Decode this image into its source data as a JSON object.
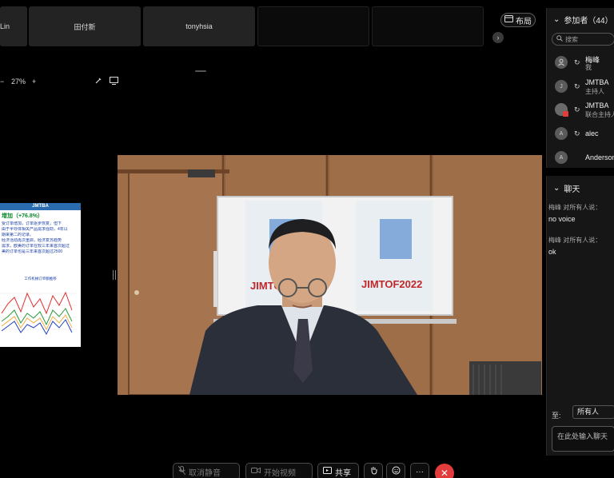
{
  "participant_tiles": [
    {
      "label": "Lin"
    },
    {
      "label": "田付新"
    },
    {
      "label": "tonyhsia"
    },
    {
      "label": ""
    },
    {
      "label": ""
    }
  ],
  "layout_button": {
    "label": "布局"
  },
  "zoom": {
    "minus": "−",
    "value": "27%",
    "plus": "+"
  },
  "shared_doc": {
    "header": "JMTBA",
    "title": "增加（+76.8%）",
    "lines": [
      "受订单增加，订单逐步恢复，但下",
      "",
      "由于半导体相关产品需求强劲，4年以",
      "期来第二的记录。",
      "经济活动再次重启，经济复苏趋势",
      "需求，欧美的订单在较三年来首次超过",
      "美的订单也是三年来首次超过2500"
    ],
    "chart_caption": "工作机械订单额推移"
  },
  "panel": {
    "title": "参加者（44）",
    "search_placeholder": "搜索",
    "participants": [
      {
        "initial": "",
        "name": "梅峰",
        "role": "我"
      },
      {
        "initial": "J",
        "name": "JMTBA",
        "role": "主持人"
      },
      {
        "initial": "",
        "name": "JMTBA",
        "role": "联合主持人"
      },
      {
        "initial": "A",
        "name": "alec",
        "role": ""
      },
      {
        "initial": "A",
        "name": "Anderson",
        "role": ""
      }
    ]
  },
  "chat": {
    "title": "聊天",
    "messages": [
      {
        "meta": "梅峰 对所有人说：",
        "text": "no voice"
      },
      {
        "meta": "梅峰 对所有人说：",
        "text": "ok"
      }
    ],
    "to_label": "至:",
    "to_value": "所有人",
    "input_placeholder": "在此处输入聊天"
  },
  "toolbar": {
    "unmute": "取消静音",
    "start_video": "开始视频",
    "share": "共享",
    "end_label": "✕"
  },
  "poster": {
    "brand": "JIMTOF",
    "brand_year": "JIMTOF2022"
  },
  "colors": {
    "end_call": "#e23c3c",
    "doc_header": "#2b6cb0",
    "panel_bg": "#161616"
  }
}
